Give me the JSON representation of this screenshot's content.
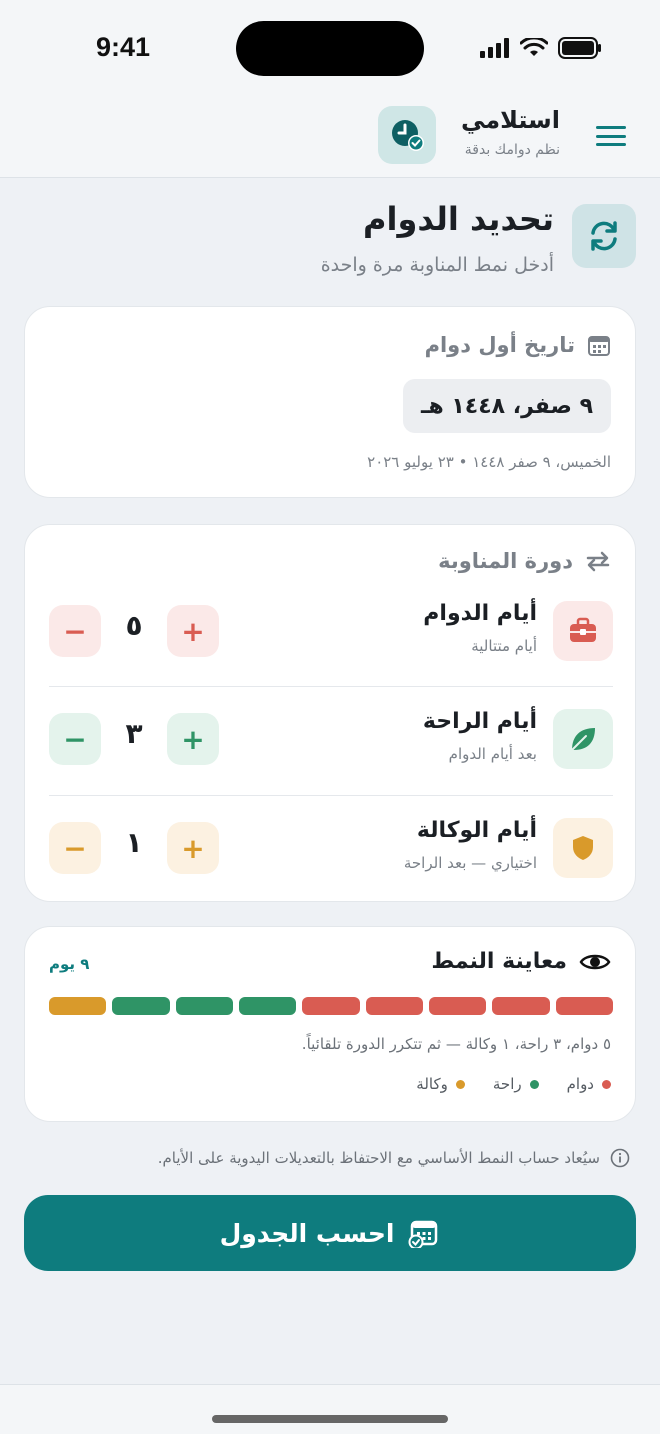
{
  "status": {
    "time": "9:41"
  },
  "app": {
    "title": "استلامي",
    "subtitle": "نظم دوامك بدقة"
  },
  "page": {
    "title": "تحديد الدوام",
    "subtitle": "أدخل نمط المناوبة مرة واحدة"
  },
  "first_date": {
    "label": "تاريخ أول دوام",
    "value": "٩ صفر، ١٤٤٨ هـ",
    "description": "الخميس، ٩ صفر ١٤٤٨ • ٢٣ يوليو ٢٠٢٦"
  },
  "cycle": {
    "label": "دورة المناوبة",
    "rows": [
      {
        "label": "أيام الدوام",
        "sub": "أيام متتالية",
        "value": "٥",
        "minus": "−",
        "plus": "+",
        "color": "#d95c52",
        "bg": "#fbe9e8"
      },
      {
        "label": "أيام الراحة",
        "sub": "بعد أيام الدوام",
        "value": "٣",
        "minus": "−",
        "plus": "+",
        "color": "#2f9466",
        "bg": "#e4f3ec"
      },
      {
        "label": "أيام الوكالة",
        "sub": "اختياري — بعد الراحة",
        "value": "١",
        "minus": "−",
        "plus": "+",
        "color": "#d99a2b",
        "bg": "#fcf1e1"
      }
    ]
  },
  "preview": {
    "title": "معاينة النمط",
    "days": "٩ يوم",
    "pattern": [
      {
        "kind": "work",
        "color": "#d95c52"
      },
      {
        "kind": "work",
        "color": "#d95c52"
      },
      {
        "kind": "work",
        "color": "#d95c52"
      },
      {
        "kind": "work",
        "color": "#d95c52"
      },
      {
        "kind": "work",
        "color": "#d95c52"
      },
      {
        "kind": "rest",
        "color": "#2f9466"
      },
      {
        "kind": "rest",
        "color": "#2f9466"
      },
      {
        "kind": "rest",
        "color": "#2f9466"
      },
      {
        "kind": "agency",
        "color": "#d99a2b"
      }
    ],
    "description": "٥ دوام، ٣ راحة، ١ وكالة — ثم تتكرر الدورة تلقائياً.",
    "legend": [
      {
        "label": "دوام",
        "color": "#d95c52"
      },
      {
        "label": "راحة",
        "color": "#2f9466"
      },
      {
        "label": "وكالة",
        "color": "#d99a2b"
      }
    ]
  },
  "note": "سيُعاد حساب النمط الأساسي مع الاحتفاظ بالتعديلات اليدوية على الأيام.",
  "calculate_button": "احسب الجدول",
  "colors": {
    "accent": "#0e7c7e"
  }
}
